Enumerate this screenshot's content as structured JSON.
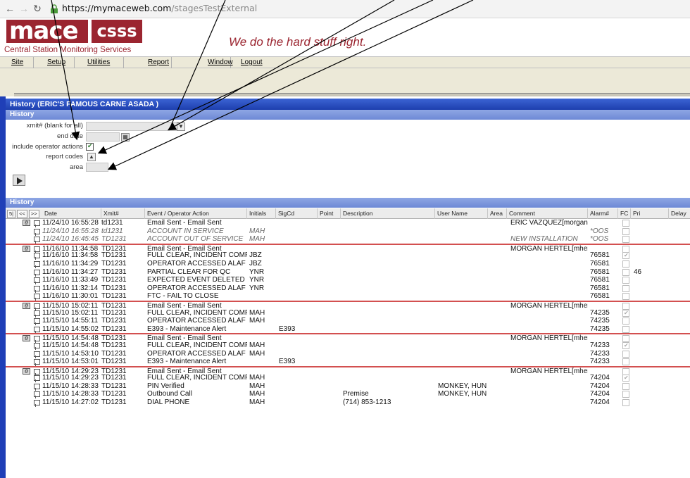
{
  "browser": {
    "url_host": "https://mymaceweb.com",
    "url_path": "/stagesTestExternal"
  },
  "header": {
    "logo_main": "mace",
    "logo_csss": "csss",
    "logo_sub": "Central Station Monitoring Services",
    "tagline": "We do the hard stuff right."
  },
  "menu": [
    "Site",
    "Setup",
    "Utilities",
    "Report",
    "Window",
    "Logout"
  ],
  "window_title": "History (ERIC'S FAMOUS CARNE ASADA )",
  "panel_title": "History",
  "form": {
    "xmit_label": "xmit# (blank for all)",
    "end_date_label": "end date",
    "include_ops_label": "include operator actions",
    "report_codes_label": "report codes",
    "area_label": "area"
  },
  "history_title": "History",
  "grid": {
    "nav": [
      "5|",
      "<<",
      ">>"
    ],
    "columns": [
      "Date",
      "Xmit#",
      "Event / Operator Action",
      "Initials",
      "SigCd",
      "Point",
      "Description",
      "User Name",
      "Area",
      "Comment",
      "Alarm#",
      "FC",
      "Pri",
      "Delay"
    ],
    "rows": [
      {
        "grp": true,
        "email": true,
        "date": "11/24/10 16:55:28",
        "xmit": "td1231",
        "event": "Email Sent - Email Sent",
        "init": "",
        "sig": "",
        "desc": "",
        "user": "",
        "comment": "ERIC VAZQUEZ[morgan(",
        "alarm": "",
        "fc": false,
        "pri": ""
      },
      {
        "grp": false,
        "gray": true,
        "date": "11/24/10 16:55:28",
        "xmit": "td1231",
        "event": "ACCOUNT IN SERVICE",
        "init": "MAH",
        "sig": "",
        "desc": "",
        "user": "",
        "comment": "",
        "alarm": "*OOS",
        "fc": false,
        "pri": ""
      },
      {
        "grp": false,
        "gray": true,
        "date": "11/24/10 16:45:45",
        "xmit": "TD1231",
        "event": "ACCOUNT OUT OF SERVICE",
        "init": "MAH",
        "sig": "",
        "desc": "",
        "user": "",
        "comment": "NEW INSTALLATION",
        "alarm": "*OOS",
        "fc": false,
        "pri": ""
      },
      {
        "grp": true,
        "email": true,
        "date": "11/16/10 11:34:58",
        "xmit": "TD1231",
        "event": "Email Sent - Email Sent",
        "init": "",
        "sig": "",
        "desc": "",
        "user": "",
        "comment": "MORGAN HERTEL[mher",
        "alarm": "",
        "fc": false,
        "pri": ""
      },
      {
        "grp": false,
        "date": "11/16/10 11:34:58",
        "xmit": "TD1231",
        "event": "FULL CLEAR, INCIDENT COMF",
        "init": "JBZ",
        "sig": "",
        "desc": "",
        "user": "",
        "comment": "",
        "alarm": "76581",
        "fc": true,
        "pri": ""
      },
      {
        "grp": false,
        "date": "11/16/10 11:34:29",
        "xmit": "TD1231",
        "event": "OPERATOR ACCESSED ALAF",
        "init": "JBZ",
        "sig": "",
        "desc": "",
        "user": "",
        "comment": "",
        "alarm": "76581",
        "fc": false,
        "pri": ""
      },
      {
        "grp": false,
        "date": "11/16/10 11:34:27",
        "xmit": "TD1231",
        "event": "PARTIAL CLEAR FOR QC",
        "init": "YNR",
        "sig": "",
        "desc": "",
        "user": "",
        "comment": "",
        "alarm": "76581",
        "fc": false,
        "pri": "46"
      },
      {
        "grp": false,
        "date": "11/16/10 11:33:49",
        "xmit": "TD1231",
        "event": "EXPECTED EVENT DELETED",
        "init": "YNR",
        "sig": "",
        "desc": "",
        "user": "",
        "comment": "",
        "alarm": "76581",
        "fc": false,
        "pri": ""
      },
      {
        "grp": false,
        "date": "11/16/10 11:32:14",
        "xmit": "TD1231",
        "event": "OPERATOR ACCESSED ALAF",
        "init": "YNR",
        "sig": "",
        "desc": "",
        "user": "",
        "comment": "",
        "alarm": "76581",
        "fc": false,
        "pri": ""
      },
      {
        "grp": false,
        "date": "11/16/10 11:30:01",
        "xmit": "TD1231",
        "event": "FTC - FAIL TO CLOSE",
        "init": "",
        "sig": "",
        "desc": "",
        "user": "",
        "comment": "",
        "alarm": "76581",
        "fc": false,
        "pri": ""
      },
      {
        "grp": true,
        "email": true,
        "date": "11/15/10 15:02:11",
        "xmit": "TD1231",
        "event": "Email Sent - Email Sent",
        "init": "",
        "sig": "",
        "desc": "",
        "user": "",
        "comment": "MORGAN HERTEL[mher",
        "alarm": "",
        "fc": false,
        "pri": ""
      },
      {
        "grp": false,
        "date": "11/15/10 15:02:11",
        "xmit": "TD1231",
        "event": "FULL CLEAR, INCIDENT COMF",
        "init": "MAH",
        "sig": "",
        "desc": "",
        "user": "",
        "comment": "",
        "alarm": "74235",
        "fc": true,
        "pri": ""
      },
      {
        "grp": false,
        "date": "11/15/10 14:55:11",
        "xmit": "TD1231",
        "event": "OPERATOR ACCESSED ALAF",
        "init": "MAH",
        "sig": "",
        "desc": "",
        "user": "",
        "comment": "",
        "alarm": "74235",
        "fc": false,
        "pri": ""
      },
      {
        "grp": false,
        "date": "11/15/10 14:55:02",
        "xmit": "TD1231",
        "event": "E393 - Maintenance Alert",
        "init": "",
        "sig": "E393",
        "desc": "",
        "user": "",
        "comment": "",
        "alarm": "74235",
        "fc": false,
        "pri": ""
      },
      {
        "grp": true,
        "email": true,
        "date": "11/15/10 14:54:48",
        "xmit": "TD1231",
        "event": "Email Sent - Email Sent",
        "init": "",
        "sig": "",
        "desc": "",
        "user": "",
        "comment": "MORGAN HERTEL[mher",
        "alarm": "",
        "fc": false,
        "pri": ""
      },
      {
        "grp": false,
        "date": "11/15/10 14:54:48",
        "xmit": "TD1231",
        "event": "FULL CLEAR, INCIDENT COMF",
        "init": "MAH",
        "sig": "",
        "desc": "",
        "user": "",
        "comment": "",
        "alarm": "74233",
        "fc": true,
        "pri": ""
      },
      {
        "grp": false,
        "date": "11/15/10 14:53:10",
        "xmit": "TD1231",
        "event": "OPERATOR ACCESSED ALAF",
        "init": "MAH",
        "sig": "",
        "desc": "",
        "user": "",
        "comment": "",
        "alarm": "74233",
        "fc": false,
        "pri": ""
      },
      {
        "grp": false,
        "date": "11/15/10 14:53:01",
        "xmit": "TD1231",
        "event": "E393 - Maintenance Alert",
        "init": "",
        "sig": "E393",
        "desc": "",
        "user": "",
        "comment": "",
        "alarm": "74233",
        "fc": false,
        "pri": ""
      },
      {
        "grp": true,
        "email": true,
        "date": "11/15/10 14:29:23",
        "xmit": "TD1231",
        "event": "Email Sent - Email Sent",
        "init": "",
        "sig": "",
        "desc": "",
        "user": "",
        "comment": "MORGAN HERTEL[mher",
        "alarm": "",
        "fc": false,
        "pri": ""
      },
      {
        "grp": false,
        "date": "11/15/10 14:29:23",
        "xmit": "TD1231",
        "event": "FULL CLEAR, INCIDENT COMF",
        "init": "MAH",
        "sig": "",
        "desc": "",
        "user": "",
        "comment": "",
        "alarm": "74204",
        "fc": true,
        "pri": ""
      },
      {
        "grp": false,
        "date": "11/15/10 14:28:33",
        "xmit": "TD1231",
        "event": "PIN Verified",
        "init": "MAH",
        "sig": "",
        "desc": "",
        "user": "MONKEY, HUN",
        "comment": "",
        "alarm": "74204",
        "fc": false,
        "pri": ""
      },
      {
        "grp": false,
        "date": "11/15/10 14:28:33",
        "xmit": "TD1231",
        "event": "Outbound Call",
        "init": "MAH",
        "sig": "",
        "desc": "Premise",
        "user": "MONKEY, HUN",
        "comment": "",
        "alarm": "74204",
        "fc": false,
        "pri": ""
      },
      {
        "grp": false,
        "date": "11/15/10 14:27:02",
        "xmit": "TD1231",
        "event": "DIAL PHONE",
        "init": "MAH",
        "sig": "",
        "desc": "(714) 853-1213",
        "user": "",
        "comment": "",
        "alarm": "74204",
        "fc": false,
        "pri": ""
      }
    ]
  }
}
